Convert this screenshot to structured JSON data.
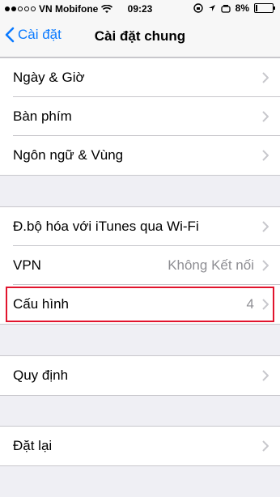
{
  "status_bar": {
    "carrier": "VN Mobifone",
    "time": "09:23",
    "battery": "8%"
  },
  "nav": {
    "back_label": "Cài đặt",
    "title": "Cài đặt chung"
  },
  "groups": [
    {
      "items": [
        {
          "label": "Ngày & Giờ"
        },
        {
          "label": "Bàn phím"
        },
        {
          "label": "Ngôn ngữ & Vùng"
        }
      ]
    },
    {
      "items": [
        {
          "label": "Đ.bộ hóa với iTunes qua Wi-Fi"
        },
        {
          "label": "VPN",
          "value": "Không Kết nối"
        },
        {
          "label": "Cấu hình",
          "value": "4"
        }
      ]
    },
    {
      "items": [
        {
          "label": "Quy định"
        }
      ]
    },
    {
      "items": [
        {
          "label": "Đặt lại"
        }
      ]
    }
  ],
  "colors": {
    "accent": "#0a7aff",
    "highlight": "#e1142d",
    "background": "#efeff4"
  }
}
